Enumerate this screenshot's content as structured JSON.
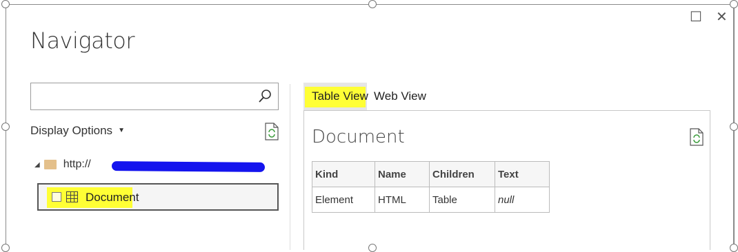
{
  "window": {
    "maximize_glyph": "☐",
    "close_glyph": "✕"
  },
  "dialog": {
    "title": "Navigator"
  },
  "left_pane": {
    "search": {
      "value": "",
      "placeholder": ""
    },
    "display_options_label": "Display Options",
    "tree": {
      "root_url": "http://",
      "root_trailing": "...",
      "items": [
        {
          "label": "Document",
          "checked": false,
          "icon": "table-icon",
          "highlight": "#ffff35"
        }
      ]
    }
  },
  "right_pane": {
    "tabs": [
      {
        "label": "Table View",
        "active": true,
        "highlight": "#ffff35"
      },
      {
        "label": "Web View",
        "active": false
      }
    ],
    "preview_title": "Document",
    "table": {
      "headers": [
        "Kind",
        "Name",
        "Children",
        "Text"
      ],
      "rows": [
        [
          "Element",
          "HTML",
          "Table",
          "null"
        ]
      ]
    }
  },
  "colors": {
    "highlight": "#ffff35",
    "redaction": "#1414ee",
    "folder": "#e4c08b"
  }
}
